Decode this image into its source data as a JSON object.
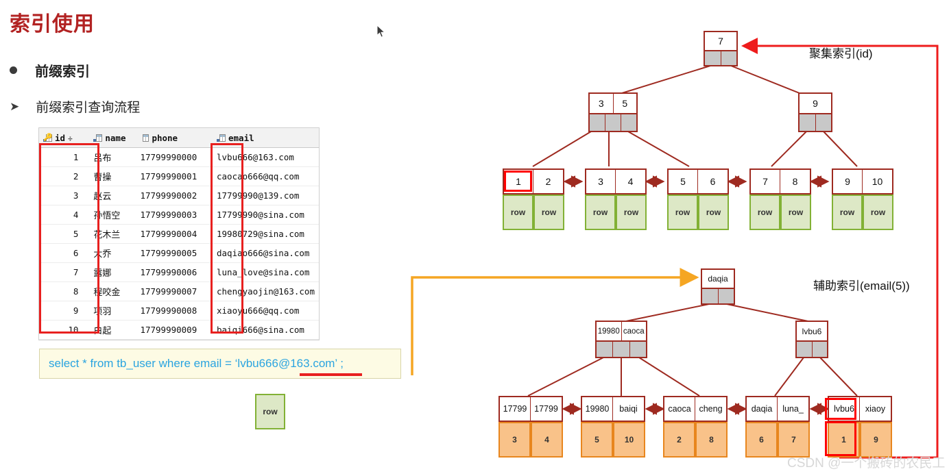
{
  "slide": {
    "title": "索引使用",
    "bullets": [
      {
        "marker": "dot",
        "text": "前缀索引"
      },
      {
        "marker": "arrow",
        "text": "前缀索引查询流程"
      }
    ]
  },
  "data_table": {
    "columns": [
      {
        "label": "id",
        "icon": "key-column-icon",
        "sortable": true,
        "sort_glyph": "÷"
      },
      {
        "label": "name",
        "icon": "table-column-icon",
        "sortable": false
      },
      {
        "label": "phone",
        "icon": "table-column-icon",
        "sortable": false
      },
      {
        "label": "email",
        "icon": "table-column-icon",
        "sortable": false
      }
    ],
    "rows": [
      {
        "id": "1",
        "name": "吕布",
        "phone": "17799990000",
        "email": "lvbu666@163.com"
      },
      {
        "id": "2",
        "name": "曹操",
        "phone": "17799990001",
        "email": "caocao666@qq.com"
      },
      {
        "id": "3",
        "name": "赵云",
        "phone": "17799990002",
        "email": "17799990@139.com"
      },
      {
        "id": "4",
        "name": "孙悟空",
        "phone": "17799990003",
        "email": "17799990@sina.com"
      },
      {
        "id": "5",
        "name": "花木兰",
        "phone": "17799990004",
        "email": "19980729@sina.com"
      },
      {
        "id": "6",
        "name": "大乔",
        "phone": "17799990005",
        "email": "daqiao666@sina.com"
      },
      {
        "id": "7",
        "name": "露娜",
        "phone": "17799990006",
        "email": "luna_love@sina.com"
      },
      {
        "id": "8",
        "name": "程咬金",
        "phone": "17799990007",
        "email": "chengyaojin@163.com"
      },
      {
        "id": "9",
        "name": "项羽",
        "phone": "17799990008",
        "email": "xiaoyu666@qq.com"
      },
      {
        "id": "10",
        "name": "白起",
        "phone": "17799990009",
        "email": "baiqi666@sina.com"
      }
    ]
  },
  "sql": {
    "text": "select * from tb_user where email = ‘lvbu666@163.com’ ;",
    "highlighted_literal": "lvbu666@163.com"
  },
  "row_sample": {
    "label": "row"
  },
  "labels": {
    "clustered_index": "聚集索引(id)",
    "secondary_index": "辅助索引(email(5))"
  },
  "clustered_index_tree": {
    "root": {
      "keys": [
        "7"
      ],
      "pointers": 2
    },
    "internal": [
      {
        "keys": [
          "3",
          "5"
        ],
        "pointers": 3
      },
      {
        "keys": [
          "9"
        ],
        "pointers": 2
      }
    ],
    "leaves": [
      {
        "keys": [
          "1",
          "2"
        ],
        "values": [
          "row",
          "row"
        ],
        "selected_key": "1"
      },
      {
        "keys": [
          "3",
          "4"
        ],
        "values": [
          "row",
          "row"
        ]
      },
      {
        "keys": [
          "5",
          "6"
        ],
        "values": [
          "row",
          "row"
        ]
      },
      {
        "keys": [
          "7",
          "8"
        ],
        "values": [
          "row",
          "row"
        ]
      },
      {
        "keys": [
          "9",
          "10"
        ],
        "values": [
          "row",
          "row"
        ]
      }
    ]
  },
  "secondary_index_tree": {
    "root": {
      "keys": [
        "daqia"
      ],
      "pointers": 2
    },
    "internal": [
      {
        "keys": [
          "19980",
          "caoca"
        ],
        "pointers": 3
      },
      {
        "keys": [
          "lvbu6"
        ],
        "pointers": 2
      }
    ],
    "leaves": [
      {
        "keys": [
          "17799",
          "17799"
        ],
        "values": [
          "3",
          "4"
        ]
      },
      {
        "keys": [
          "19980",
          "baiqi"
        ],
        "values": [
          "5",
          "10"
        ]
      },
      {
        "keys": [
          "caoca",
          "cheng"
        ],
        "values": [
          "2",
          "8"
        ]
      },
      {
        "keys": [
          "daqia",
          "luna_"
        ],
        "values": [
          "6",
          "7"
        ]
      },
      {
        "keys": [
          "lvbu6",
          "xiaoy"
        ],
        "values": [
          "1",
          "9"
        ],
        "selected_key": "lvbu6",
        "selected_value": "1"
      }
    ]
  },
  "watermark": "CSDN @一个搬砖的农民工",
  "colors": {
    "title_red": "#b22222",
    "node_border": "#9e2a20",
    "pointer_gray": "#c8c8c8",
    "row_green_fill": "#dde8c6",
    "row_green_border": "#82b135",
    "id_orange_fill": "#f9c289",
    "id_orange_border": "#e8861e",
    "selection_red": "#ff0000",
    "lookup_arrow_orange": "#f5a623",
    "sql_text_blue": "#2aa4e0",
    "sql_box_bg": "#fdfbe4"
  }
}
